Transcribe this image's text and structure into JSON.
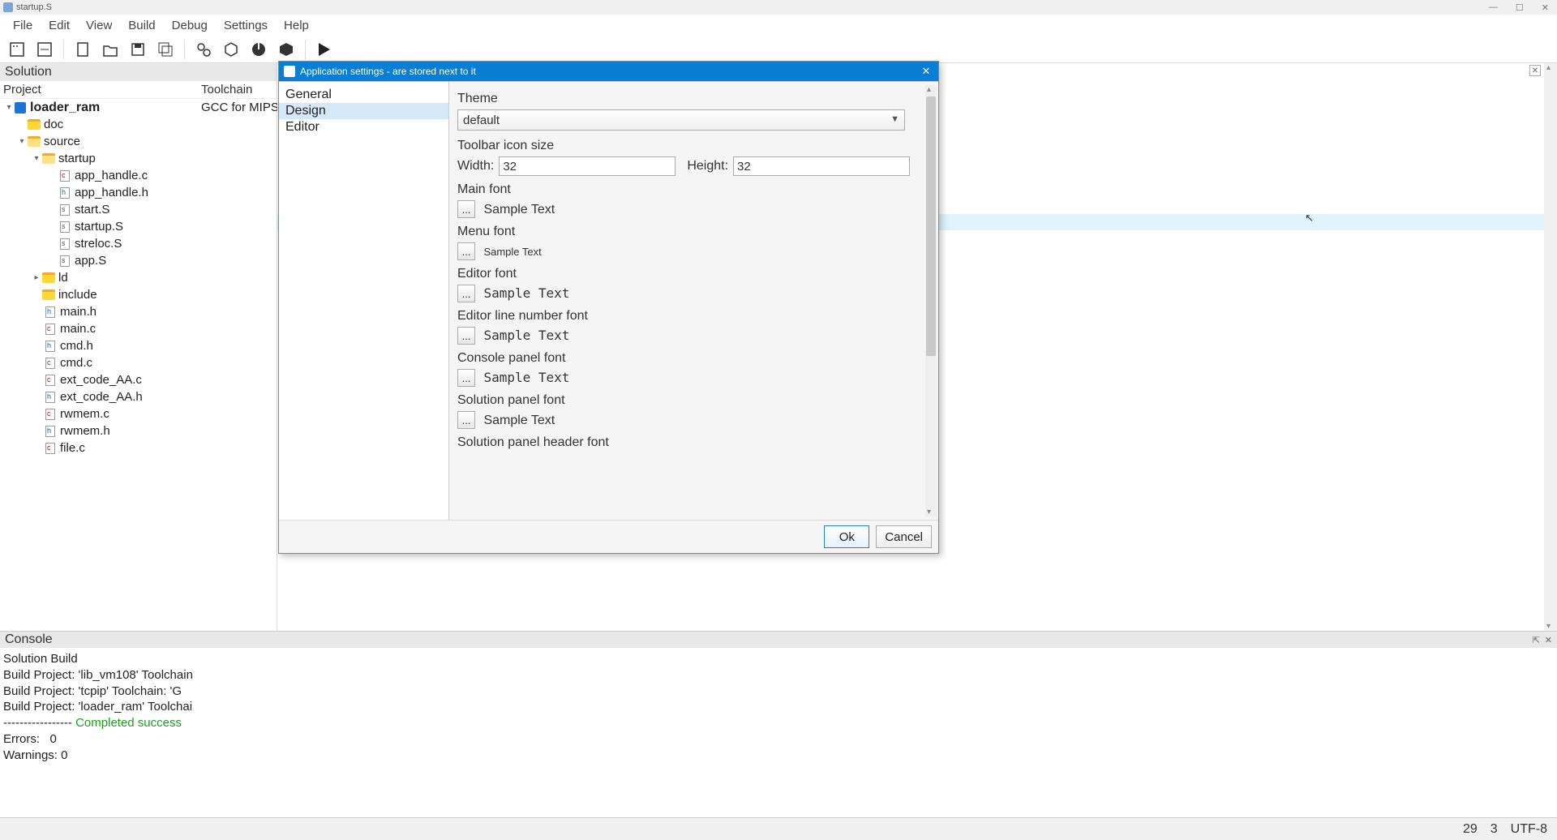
{
  "window": {
    "title": "startup.S"
  },
  "menubar": [
    "File",
    "Edit",
    "View",
    "Build",
    "Debug",
    "Settings",
    "Help"
  ],
  "solution": {
    "header": "Solution",
    "cols": {
      "project": "Project",
      "toolchain": "Toolchain"
    },
    "root": {
      "name": "loader_ram",
      "toolchain": "GCC for MIPS"
    },
    "tree": {
      "doc": "doc",
      "source": "source",
      "startup": "startup",
      "ld": "ld",
      "include": "include",
      "files": {
        "app_handle_c": "app_handle.c",
        "app_handle_h": "app_handle.h",
        "start_s": "start.S",
        "startup_s": "startup.S",
        "streloc_s": "streloc.S",
        "app_s": "app.S",
        "main_h": "main.h",
        "main_c": "main.c",
        "cmd_h": "cmd.h",
        "cmd_c": "cmd.c",
        "ext_code_aa_c": "ext_code_AA.c",
        "ext_code_aa_h": "ext_code_AA.h",
        "rwmem_c": "rwmem.c",
        "rwmem_h": "rwmem.h",
        "file_c": "file.c"
      }
    }
  },
  "console": {
    "header": "Console",
    "lines": {
      "l0": "Solution Build",
      "l1": "Build Project: 'lib_vm108' Toolchain",
      "l2": "Build Project: 'tcpip' Toolchain: 'G",
      "l3": "Build Project: 'loader_ram' Toolchai",
      "l4a": "----------------- ",
      "l4b": "Completed success",
      "l5": "Errors:   0",
      "l6": "Warnings: 0"
    }
  },
  "status": {
    "line": "29",
    "col": "3",
    "enc": "UTF-8"
  },
  "dialog": {
    "title": "Application settings - are stored next to it",
    "categories": {
      "general": "General",
      "design": "Design",
      "editor": "Editor"
    },
    "theme_label": "Theme",
    "theme_value": "default",
    "toolbar_icon_label": "Toolbar icon size",
    "width_label": "Width:",
    "height_label": "Height:",
    "width_value": "32",
    "height_value": "32",
    "main_font_label": "Main font",
    "menu_font_label": "Menu font",
    "editor_font_label": "Editor font",
    "editor_ln_font_label": "Editor line number font",
    "console_font_label": "Console panel font",
    "solution_font_label": "Solution panel font",
    "solution_header_font_label": "Solution panel header font",
    "sample": "Sample Text",
    "ellipsis": "...",
    "ok": "Ok",
    "cancel": "Cancel"
  }
}
